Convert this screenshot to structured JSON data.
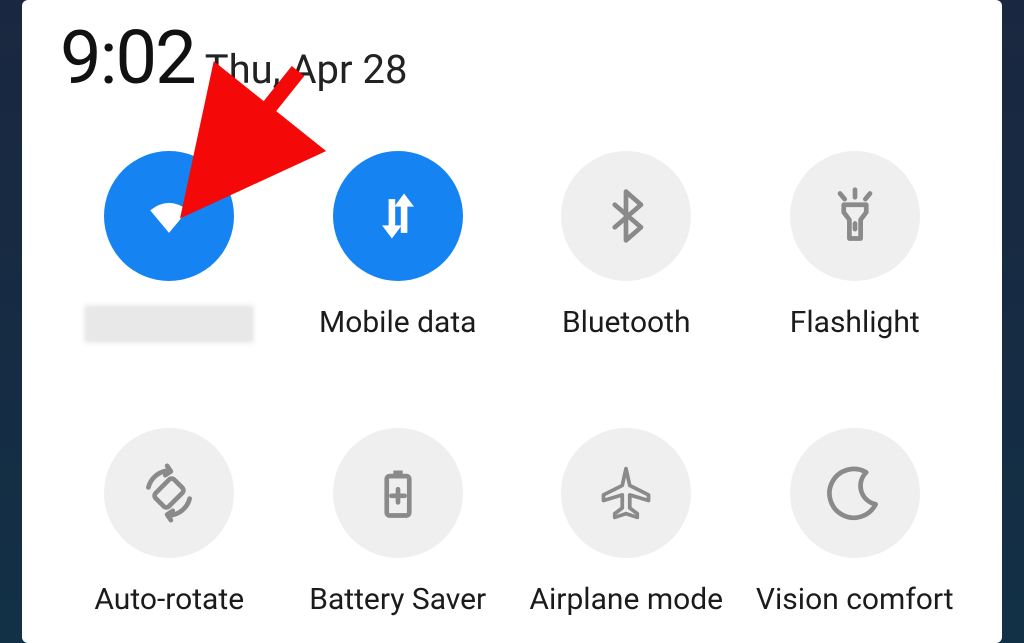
{
  "header": {
    "time": "9:02",
    "date": "Thu, Apr 28"
  },
  "colors": {
    "active_bg": "#1584f2",
    "inactive_bg": "#efefef",
    "arrow": "#f40808"
  },
  "tiles": {
    "wifi": {
      "icon": "wifi-icon",
      "label": "",
      "active": true,
      "label_redacted": true
    },
    "mobile": {
      "icon": "mobile-data-icon",
      "label": "Mobile data",
      "active": true
    },
    "bluetooth": {
      "icon": "bluetooth-icon",
      "label": "Bluetooth",
      "active": false
    },
    "flashlight": {
      "icon": "flashlight-icon",
      "label": "Flashlight",
      "active": false
    },
    "autorotate": {
      "icon": "auto-rotate-icon",
      "label": "Auto-rotate",
      "active": false
    },
    "battery": {
      "icon": "battery-saver-icon",
      "label": "Battery Saver",
      "active": false
    },
    "airplane": {
      "icon": "airplane-mode-icon",
      "label": "Airplane mode",
      "active": false
    },
    "vision": {
      "icon": "vision-comfort-icon",
      "label": "Vision comfort",
      "active": false
    }
  },
  "annotation": {
    "arrow_points_to": "wifi"
  }
}
